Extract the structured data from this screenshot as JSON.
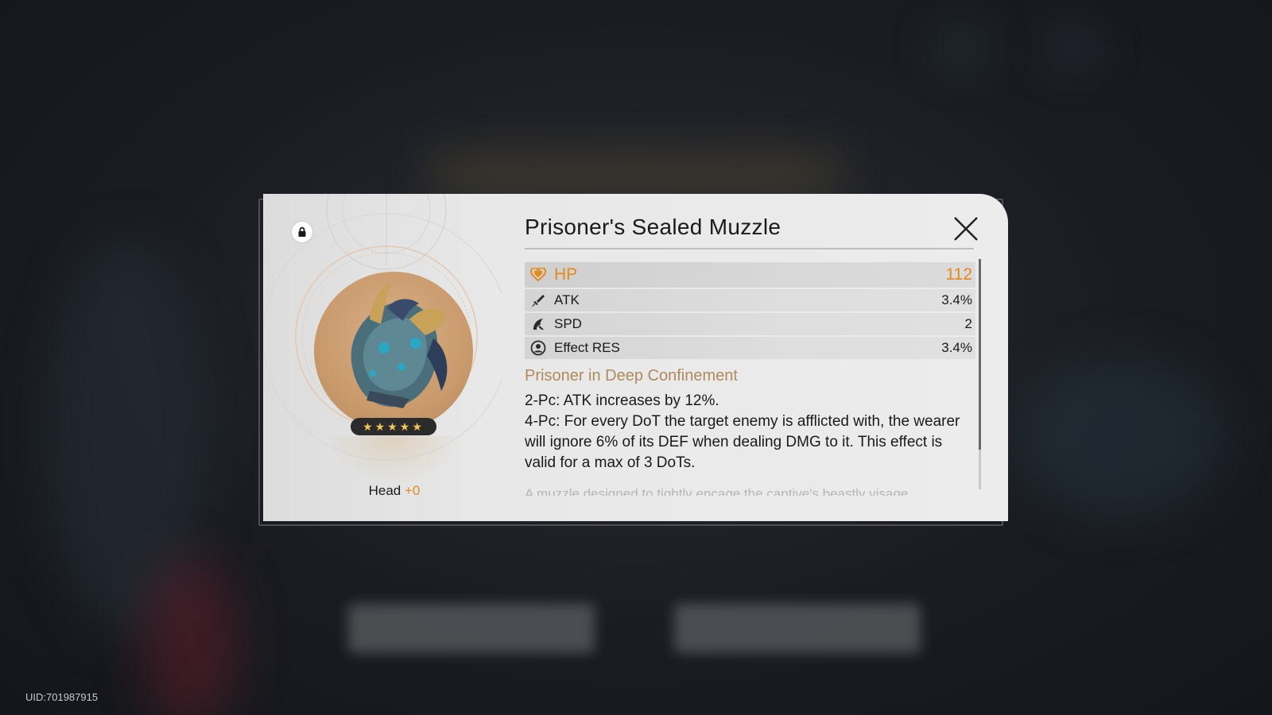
{
  "relic": {
    "name": "Prisoner's Sealed Muzzle",
    "slot": "Head",
    "level": "+0",
    "stars": "★★★★★",
    "rarity": 5
  },
  "main_stat": {
    "name": "HP",
    "value": "112",
    "icon": "hp-icon"
  },
  "sub_stats": [
    {
      "name": "ATK",
      "value": "3.4%",
      "icon": "atk-icon"
    },
    {
      "name": "SPD",
      "value": "2",
      "icon": "spd-icon"
    },
    {
      "name": "Effect RES",
      "value": "3.4%",
      "icon": "effect-res-icon"
    }
  ],
  "set": {
    "name": "Prisoner in Deep Confinement",
    "bonus_2pc": "2-Pc: ATK increases by 12%.",
    "bonus_4pc": "4-Pc: For every DoT the target enemy is afflicted with, the wearer will ignore 6% of its DEF when dealing DMG to it. This effect is valid for a max of 3 DoTs.",
    "lore": "A muzzle designed to tightly encage the captive's beastly visage"
  },
  "uid": "UID:701987915",
  "colors": {
    "accent": "#e58a19",
    "set_name": "#b08a5a",
    "panel": "#e8e8e8"
  },
  "icons": {
    "lock": "lock-icon",
    "close": "close-icon"
  }
}
